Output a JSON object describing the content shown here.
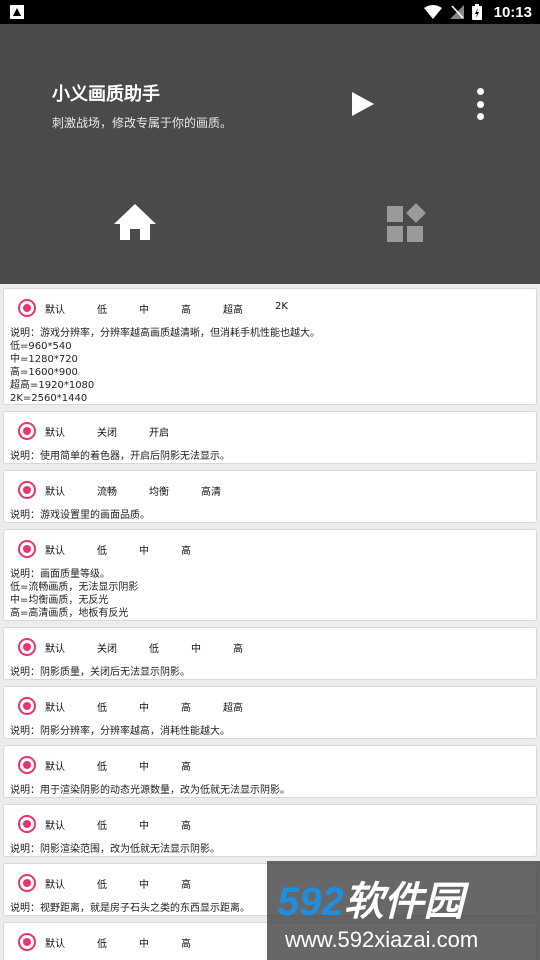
{
  "status_bar": {
    "time": "10:13"
  },
  "header": {
    "title": "小义画质助手",
    "subtitle": "刺激战场，修改专属于你的画质。"
  },
  "cards": [
    {
      "options": [
        "默认",
        "低",
        "中",
        "高",
        "超高",
        "2K"
      ],
      "description": "说明：游戏分辨率，分辨率越高画质越清晰，但消耗手机性能也越大。\n低=960*540\n中=1280*720\n高=1600*900\n超高=1920*1080\n2K=2560*1440"
    },
    {
      "options": [
        "默认",
        "关闭",
        "开启"
      ],
      "description": "说明：使用简单的着色器，开启后阴影无法显示。"
    },
    {
      "options": [
        "默认",
        "流畅",
        "均衡",
        "高清"
      ],
      "description": "说明：游戏设置里的画面品质。"
    },
    {
      "options": [
        "默认",
        "低",
        "中",
        "高"
      ],
      "description": "说明：画面质量等级。\n低=流畅画质，无法显示阴影\n中=均衡画质，无反光\n高=高清画质，地板有反光"
    },
    {
      "options": [
        "默认",
        "关闭",
        "低",
        "中",
        "高"
      ],
      "description": "说明：阴影质量，关闭后无法显示阴影。"
    },
    {
      "options": [
        "默认",
        "低",
        "中",
        "高",
        "超高"
      ],
      "description": "说明：阴影分辨率，分辨率越高，消耗性能越大。"
    },
    {
      "options": [
        "默认",
        "低",
        "中",
        "高"
      ],
      "description": "说明：用于渲染阴影的动态光源数量，改为低就无法显示阴影。"
    },
    {
      "options": [
        "默认",
        "低",
        "中",
        "高"
      ],
      "description": "说明：阴影渲染范围，改为低就无法显示阴影。"
    },
    {
      "options": [
        "默认",
        "低",
        "中",
        "高"
      ],
      "description": "说明：视野距离，就是房子石头之类的东西显示距离。"
    },
    {
      "options": [
        "默认",
        "低",
        "中",
        "高"
      ],
      "description": ""
    }
  ],
  "watermark": {
    "brand_num": "592",
    "brand_text": "软件园",
    "url": "www.592xiazai.com"
  },
  "colors": {
    "accent": "#e8356e",
    "header_bg": "#4a4a4a",
    "list_bg": "#ececec"
  }
}
